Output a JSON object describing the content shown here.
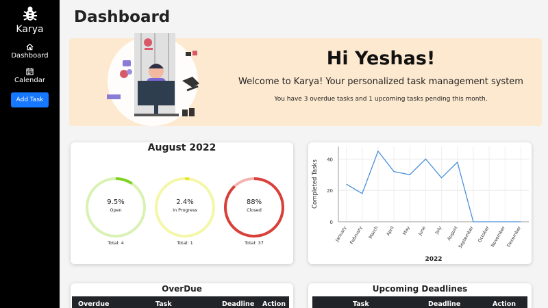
{
  "sidebar": {
    "brand": "Karya",
    "items": [
      {
        "label": "Dashboard",
        "icon": "home-icon"
      },
      {
        "label": "Calendar",
        "icon": "calendar-icon"
      }
    ],
    "add_task_label": "Add Task",
    "accent": "#1677ff"
  },
  "page": {
    "title": "Dashboard"
  },
  "banner": {
    "greeting": "Hi Yeshas!",
    "welcome": "Welcome to Karya! Your personalized task management system",
    "pending": "You have 3 overdue tasks and 1 upcoming tasks pending this month.",
    "background": "#fde9cf"
  },
  "month_summary": {
    "title": "August 2022",
    "stats": [
      {
        "percent": "9.5%",
        "label": "Open",
        "total": "Total: 4",
        "fraction": 0.095,
        "color": "#7ed321",
        "track": "#d9f2b4"
      },
      {
        "percent": "2.4%",
        "label": "In Progress",
        "total": "Total: 1",
        "fraction": 0.024,
        "color": "#e6ea2c",
        "track": "#f4f6a8"
      },
      {
        "percent": "88%",
        "label": "Closed",
        "total": "Total: 37",
        "fraction": 0.88,
        "color": "#d9403a",
        "track": "#f3b4b1"
      }
    ]
  },
  "chart_data": {
    "type": "line",
    "categories": [
      "January",
      "February",
      "March",
      "April",
      "May",
      "June",
      "July",
      "August",
      "September",
      "October",
      "November",
      "December"
    ],
    "series": [
      {
        "values": [
          24,
          18,
          45,
          32,
          30,
          40,
          28,
          38,
          0,
          0,
          0,
          0
        ]
      }
    ],
    "xlabel": "2022",
    "ylabel": "Completed Tasks",
    "yticks": [
      0,
      20,
      40
    ],
    "ylim": [
      0,
      48
    ],
    "grid": true,
    "line_color": "#4a90d9"
  },
  "overdue": {
    "title": "OverDue",
    "columns": [
      "Overdue",
      "Task",
      "Deadline",
      "Action"
    ]
  },
  "upcoming": {
    "title": "Upcoming Deadlines",
    "columns": [
      "Task",
      "Deadline",
      "Action"
    ]
  }
}
